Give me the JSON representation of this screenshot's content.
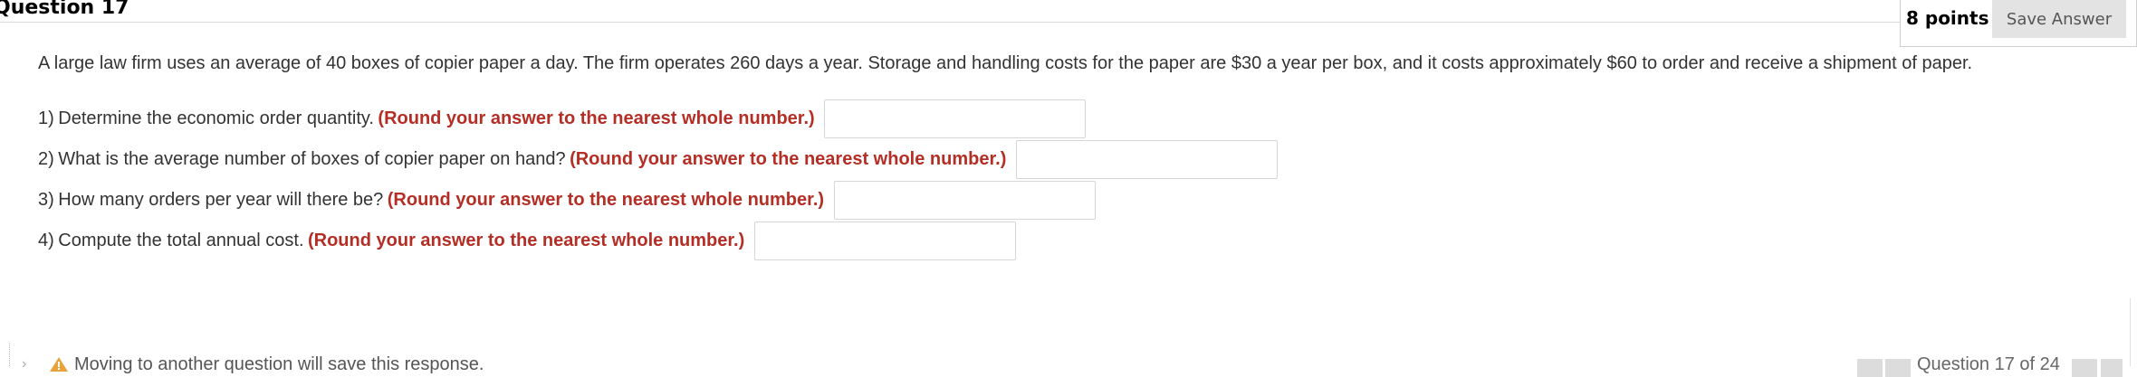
{
  "question": {
    "title": "Question 17",
    "points_label": "8 points",
    "save_label": "Save Answer",
    "prompt": "A large law firm uses an average of 40 boxes of copier paper a day. The firm operates 260 days a year. Storage and handling costs for the paper are $30 a year per box, and it costs approximately $60 to order and receive a shipment of paper.",
    "parts": [
      {
        "num": "1)",
        "text": "Determine the economic order quantity.",
        "hint": "(Round your answer to the nearest whole number.)",
        "value": ""
      },
      {
        "num": "2)",
        "text": "What is the average number of boxes of copier paper on hand?",
        "hint": "(Round your answer to the nearest whole number.)",
        "value": ""
      },
      {
        "num": "3)",
        "text": "How many orders per year will there be?",
        "hint": "(Round your answer to the nearest whole number.)",
        "value": ""
      },
      {
        "num": "4)",
        "text": "Compute the total annual cost.",
        "hint": "(Round your answer to the nearest whole number.)",
        "value": ""
      }
    ]
  },
  "footer": {
    "message": "Moving to another question will save this response.",
    "nav_text": "Question 17 of 24",
    "warn_color": "#e8a33d"
  }
}
